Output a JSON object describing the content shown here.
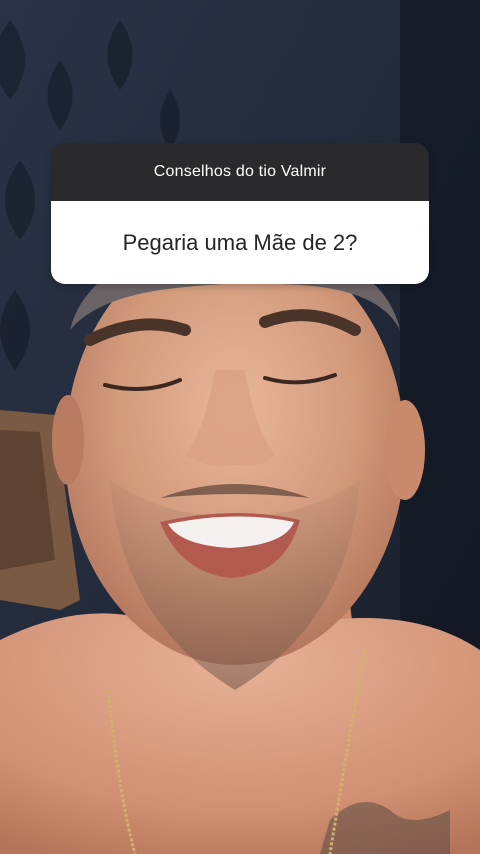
{
  "story": {
    "background": "video-frame-photo",
    "colors": {
      "card_header": "#2a2a2c",
      "card_body": "#ffffff",
      "header_text": "#ffffff",
      "question_text": "#262626"
    }
  },
  "question_sticker": {
    "header": "Conselhos do tio Valmir",
    "question": "Pegaria uma Mãe de 2?"
  }
}
